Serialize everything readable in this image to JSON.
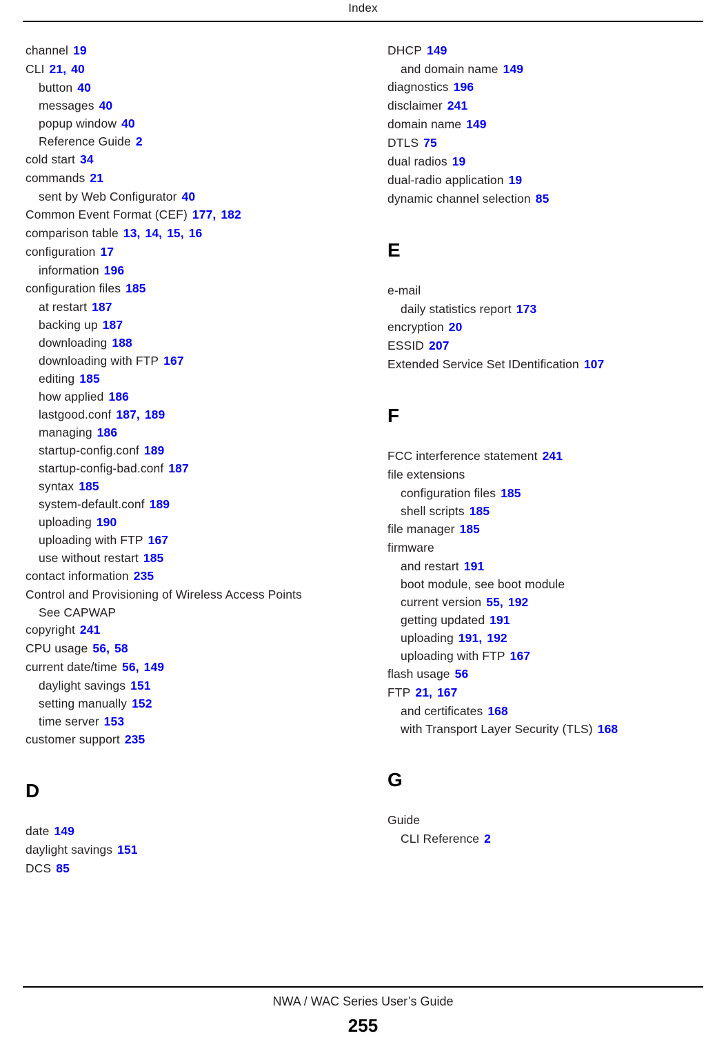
{
  "header": {
    "title": "Index"
  },
  "footer": {
    "guide_title": "NWA / WAC Series User’s Guide",
    "page_number": "255"
  },
  "colors": {
    "reference_blue": "#0000FF",
    "text_black": "#231F20",
    "rule_black": "#000000"
  },
  "columns": [
    {
      "name": "left-column",
      "blocks": [
        {
          "type": "entries",
          "entries": [
            {
              "level": 0,
              "term": "channel",
              "refs": [
                "19"
              ]
            },
            {
              "level": 0,
              "term": "CLI",
              "refs": [
                "21",
                "40"
              ]
            },
            {
              "level": 1,
              "term": "button",
              "refs": [
                "40"
              ]
            },
            {
              "level": 1,
              "term": "messages",
              "refs": [
                "40"
              ]
            },
            {
              "level": 1,
              "term": "popup window",
              "refs": [
                "40"
              ]
            },
            {
              "level": 1,
              "term": "Reference Guide",
              "refs": [
                "2"
              ]
            },
            {
              "level": 0,
              "term": "cold start",
              "refs": [
                "34"
              ]
            },
            {
              "level": 0,
              "term": "commands",
              "refs": [
                "21"
              ]
            },
            {
              "level": 1,
              "term": "sent by Web Configurator",
              "refs": [
                "40"
              ]
            },
            {
              "level": 0,
              "term": "Common Event Format (CEF)",
              "refs": [
                "177",
                "182"
              ]
            },
            {
              "level": 0,
              "term": "comparison table",
              "refs": [
                "13",
                "14",
                "15",
                "16"
              ]
            },
            {
              "level": 0,
              "term": "configuration",
              "refs": [
                "17"
              ]
            },
            {
              "level": 1,
              "term": "information",
              "refs": [
                "196"
              ]
            },
            {
              "level": 0,
              "term": "configuration files",
              "refs": [
                "185"
              ]
            },
            {
              "level": 1,
              "term": "at restart",
              "refs": [
                "187"
              ]
            },
            {
              "level": 1,
              "term": "backing up",
              "refs": [
                "187"
              ]
            },
            {
              "level": 1,
              "term": "downloading",
              "refs": [
                "188"
              ]
            },
            {
              "level": 1,
              "term": "downloading with FTP",
              "refs": [
                "167"
              ]
            },
            {
              "level": 1,
              "term": "editing",
              "refs": [
                "185"
              ]
            },
            {
              "level": 1,
              "term": "how applied",
              "refs": [
                "186"
              ]
            },
            {
              "level": 1,
              "term": "lastgood.conf",
              "refs": [
                "187",
                "189"
              ]
            },
            {
              "level": 1,
              "term": "managing",
              "refs": [
                "186"
              ]
            },
            {
              "level": 1,
              "term": "startup-config.conf",
              "refs": [
                "189"
              ]
            },
            {
              "level": 1,
              "term": "startup-config-bad.conf",
              "refs": [
                "187"
              ]
            },
            {
              "level": 1,
              "term": "syntax",
              "refs": [
                "185"
              ]
            },
            {
              "level": 1,
              "term": "system-default.conf",
              "refs": [
                "189"
              ]
            },
            {
              "level": 1,
              "term": "uploading",
              "refs": [
                "190"
              ]
            },
            {
              "level": 1,
              "term": "uploading with FTP",
              "refs": [
                "167"
              ]
            },
            {
              "level": 1,
              "term": "use without restart",
              "refs": [
                "185"
              ]
            },
            {
              "level": 0,
              "term": "contact information",
              "refs": [
                "235"
              ]
            },
            {
              "level": 0,
              "term": "Control and Provisioning of Wireless Access Points",
              "refs": []
            },
            {
              "level": 1,
              "term": "See CAPWAP",
              "refs": [],
              "tight": true
            },
            {
              "level": 0,
              "term": "copyright",
              "refs": [
                "241"
              ]
            },
            {
              "level": 0,
              "term": "CPU usage",
              "refs": [
                "56",
                "58"
              ]
            },
            {
              "level": 0,
              "term": "current date/time",
              "refs": [
                "56",
                "149"
              ]
            },
            {
              "level": 1,
              "term": "daylight savings",
              "refs": [
                "151"
              ]
            },
            {
              "level": 1,
              "term": "setting manually",
              "refs": [
                "152"
              ]
            },
            {
              "level": 1,
              "term": "time server",
              "refs": [
                "153"
              ]
            },
            {
              "level": 0,
              "term": "customer support",
              "refs": [
                "235"
              ]
            }
          ]
        },
        {
          "type": "section",
          "letter": "D"
        },
        {
          "type": "entries",
          "entries": [
            {
              "level": 0,
              "term": "date",
              "refs": [
                "149"
              ]
            },
            {
              "level": 0,
              "term": "daylight savings",
              "refs": [
                "151"
              ]
            },
            {
              "level": 0,
              "term": "DCS",
              "refs": [
                "85"
              ]
            }
          ]
        }
      ]
    },
    {
      "name": "right-column",
      "blocks": [
        {
          "type": "entries",
          "entries": [
            {
              "level": 0,
              "term": "DHCP",
              "refs": [
                "149"
              ]
            },
            {
              "level": 1,
              "term": "and domain name",
              "refs": [
                "149"
              ]
            },
            {
              "level": 0,
              "term": "diagnostics",
              "refs": [
                "196"
              ]
            },
            {
              "level": 0,
              "term": "disclaimer",
              "refs": [
                "241"
              ]
            },
            {
              "level": 0,
              "term": "domain name",
              "refs": [
                "149"
              ]
            },
            {
              "level": 0,
              "term": "DTLS",
              "refs": [
                "75"
              ]
            },
            {
              "level": 0,
              "term": "dual radios",
              "refs": [
                "19"
              ]
            },
            {
              "level": 0,
              "term": "dual-radio application",
              "refs": [
                "19"
              ]
            },
            {
              "level": 0,
              "term": "dynamic channel selection",
              "refs": [
                "85"
              ]
            }
          ]
        },
        {
          "type": "section",
          "letter": "E"
        },
        {
          "type": "entries",
          "entries": [
            {
              "level": 0,
              "term": "e-mail",
              "refs": []
            },
            {
              "level": 1,
              "term": "daily statistics report",
              "refs": [
                "173"
              ]
            },
            {
              "level": 0,
              "term": "encryption",
              "refs": [
                "20"
              ]
            },
            {
              "level": 0,
              "term": "ESSID",
              "refs": [
                "207"
              ]
            },
            {
              "level": 0,
              "term": "Extended Service Set IDentification",
              "refs": [
                "107"
              ]
            }
          ]
        },
        {
          "type": "section",
          "letter": "F"
        },
        {
          "type": "entries",
          "entries": [
            {
              "level": 0,
              "term": "FCC interference statement",
              "refs": [
                "241"
              ]
            },
            {
              "level": 0,
              "term": "file extensions",
              "refs": []
            },
            {
              "level": 1,
              "term": "configuration files",
              "refs": [
                "185"
              ]
            },
            {
              "level": 1,
              "term": "shell scripts",
              "refs": [
                "185"
              ]
            },
            {
              "level": 0,
              "term": "file manager",
              "refs": [
                "185"
              ]
            },
            {
              "level": 0,
              "term": "firmware",
              "refs": []
            },
            {
              "level": 1,
              "term": "and restart",
              "refs": [
                "191"
              ]
            },
            {
              "level": 1,
              "term": "boot module, see boot module",
              "refs": []
            },
            {
              "level": 1,
              "term": "current version",
              "refs": [
                "55",
                "192"
              ]
            },
            {
              "level": 1,
              "term": "getting updated",
              "refs": [
                "191"
              ]
            },
            {
              "level": 1,
              "term": "uploading",
              "refs": [
                "191",
                "192"
              ]
            },
            {
              "level": 1,
              "term": "uploading with FTP",
              "refs": [
                "167"
              ]
            },
            {
              "level": 0,
              "term": "flash usage",
              "refs": [
                "56"
              ]
            },
            {
              "level": 0,
              "term": "FTP",
              "refs": [
                "21",
                "167"
              ]
            },
            {
              "level": 1,
              "term": "and certificates",
              "refs": [
                "168"
              ]
            },
            {
              "level": 1,
              "term": "with Transport Layer Security (TLS)",
              "refs": [
                "168"
              ]
            }
          ]
        },
        {
          "type": "section",
          "letter": "G"
        },
        {
          "type": "entries",
          "entries": [
            {
              "level": 0,
              "term": "Guide",
              "refs": []
            },
            {
              "level": 1,
              "term": "CLI Reference",
              "refs": [
                "2"
              ]
            }
          ]
        }
      ]
    }
  ]
}
